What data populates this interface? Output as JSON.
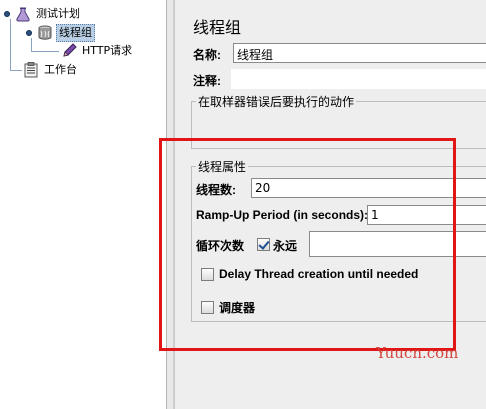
{
  "tree": {
    "test_plan_label": "测试计划",
    "thread_group_label": "线程组",
    "http_request_label": "HTTP请求",
    "workbench_label": "工作台"
  },
  "editor": {
    "title": "线程组",
    "name_label": "名称:",
    "name_value": "线程组",
    "comment_label": "注释:",
    "comment_value": "",
    "sampler_error_group_title": "在取样器错误后要执行的动作",
    "thread_props_title": "线程属性",
    "threads_label": "线程数:",
    "threads_value": "20",
    "rampup_label": "Ramp-Up Period (in seconds):",
    "rampup_value": "1",
    "loop_label": "循环次数",
    "forever_label": "永远",
    "forever_checked": true,
    "loop_value": "",
    "delay_label": "Delay Thread creation until needed",
    "delay_checked": false,
    "scheduler_label": "调度器",
    "scheduler_checked": false
  },
  "overlay": {
    "highlight_color": "#e01616",
    "watermark_text": "Yuucn.com",
    "watermark_color": "#d2453d"
  },
  "icons": [
    "flask-icon",
    "thread-group-icon",
    "pen-icon",
    "clipboard-icon"
  ]
}
